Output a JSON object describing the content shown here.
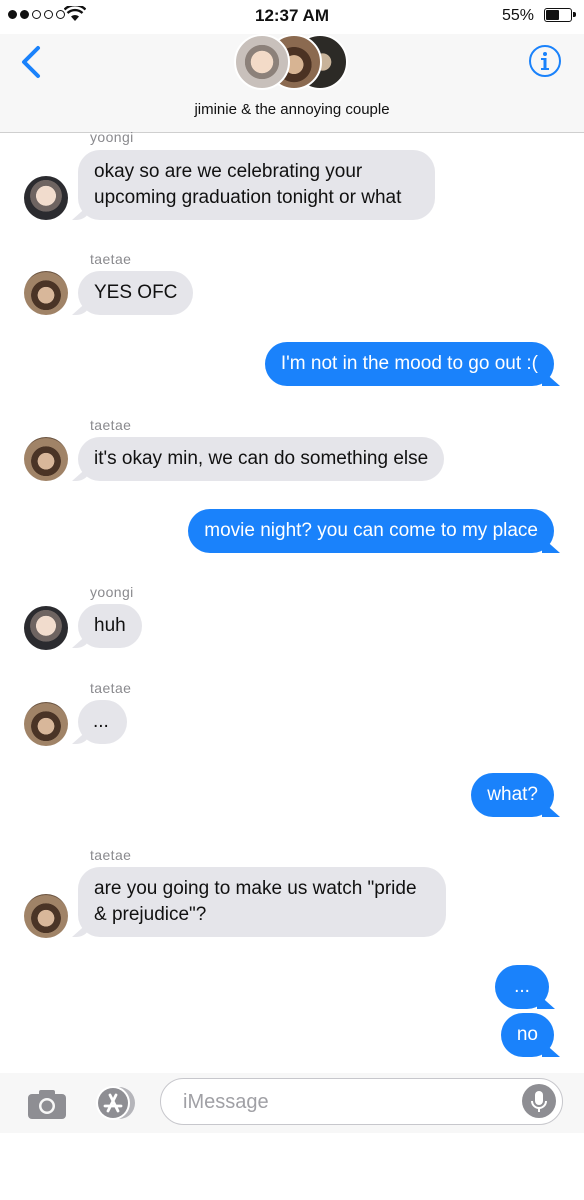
{
  "status_bar": {
    "time": "12:37 AM",
    "battery_percent": "55%",
    "battery_level": 0.55,
    "signal_bars_filled": 2,
    "signal_bars_total": 5
  },
  "header": {
    "group_title": "jiminie & the annoying couple",
    "back_icon": "chevron-left-icon",
    "info_icon": "info-icon",
    "accent_color": "#1a82fb"
  },
  "messages": [
    {
      "from": "yoongi",
      "direction": "in",
      "sender_label": "yoongi",
      "lines": [
        "okay so are we celebrating your",
        "upcoming graduation tonight or what"
      ]
    },
    {
      "from": "taetae",
      "direction": "in",
      "sender_label": "taetae",
      "lines": [
        "YES OFC"
      ]
    },
    {
      "from": "me",
      "direction": "out",
      "lines": [
        "I'm not in the mood to go out :("
      ]
    },
    {
      "from": "taetae",
      "direction": "in",
      "sender_label": "taetae",
      "lines": [
        "it's okay min, we can do something else"
      ]
    },
    {
      "from": "me",
      "direction": "out",
      "lines": [
        "movie night? you can come to my place"
      ]
    },
    {
      "from": "yoongi",
      "direction": "in",
      "sender_label": "yoongi",
      "lines": [
        "huh"
      ]
    },
    {
      "from": "taetae",
      "direction": "in",
      "sender_label": "taetae",
      "lines": [
        "..."
      ]
    },
    {
      "from": "me",
      "direction": "out",
      "lines": [
        "what?"
      ]
    },
    {
      "from": "taetae",
      "direction": "in",
      "sender_label": "taetae",
      "lines": [
        "are you going to make us watch \"pride",
        "& prejudice\"?"
      ]
    },
    {
      "from": "me",
      "direction": "out",
      "lines": [
        "..."
      ]
    },
    {
      "from": "me",
      "direction": "out",
      "lines": [
        "no"
      ]
    }
  ],
  "input_bar": {
    "placeholder": "iMessage",
    "camera_icon": "camera-icon",
    "apps_icon": "app-store-icon",
    "mic_icon": "microphone-icon"
  },
  "colors": {
    "outgoing_bubble": "#1a82fb",
    "incoming_bubble": "#e5e5ea",
    "sender_label": "#8a8a8e"
  }
}
